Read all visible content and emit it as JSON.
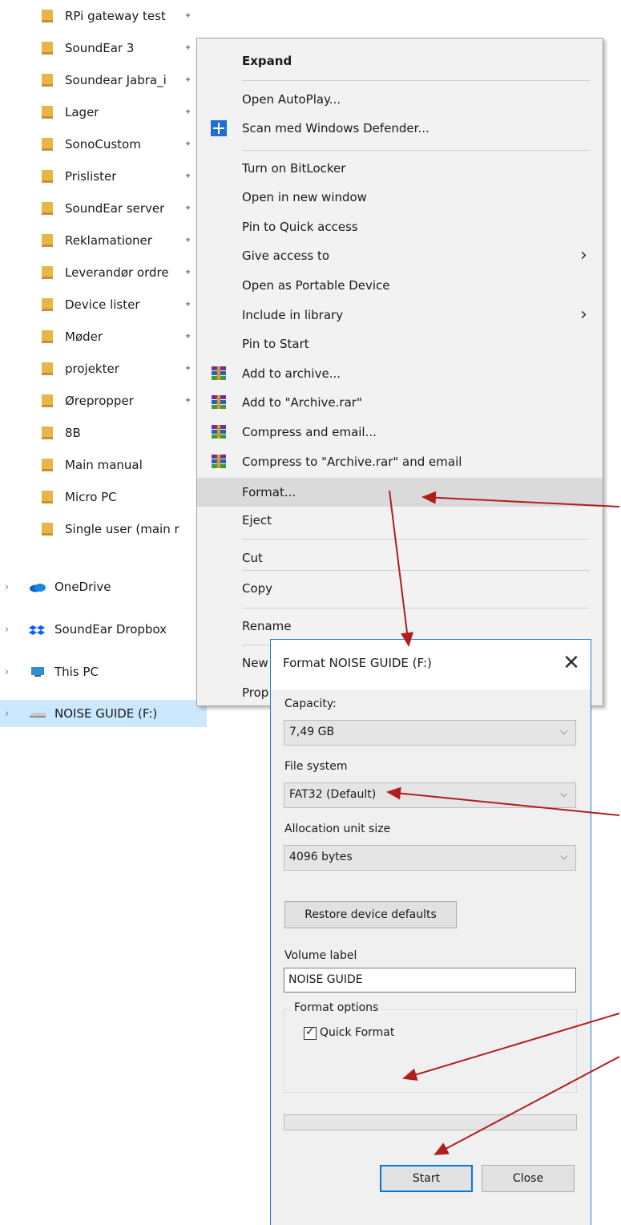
{
  "nav": {
    "folders": [
      {
        "label": "RPi gateway test",
        "pinned": true
      },
      {
        "label": "SoundEar 3",
        "pinned": true
      },
      {
        "label": "Soundear Jabra_i",
        "pinned": true
      },
      {
        "label": "Lager",
        "pinned": true
      },
      {
        "label": "SonoCustom",
        "pinned": true
      },
      {
        "label": "Prislister",
        "pinned": true
      },
      {
        "label": "SoundEar server",
        "pinned": true
      },
      {
        "label": "Reklamationer",
        "pinned": true
      },
      {
        "label": "Leverandør ordre",
        "pinned": true
      },
      {
        "label": "Device lister",
        "pinned": true
      },
      {
        "label": "Møder",
        "pinned": true
      },
      {
        "label": "projekter",
        "pinned": true
      },
      {
        "label": "Ørepropper",
        "pinned": true
      },
      {
        "label": "8B",
        "pinned": false
      },
      {
        "label": "Main manual",
        "pinned": false
      },
      {
        "label": "Micro PC",
        "pinned": false
      },
      {
        "label": "Single user (main r",
        "pinned": false
      }
    ],
    "roots": [
      {
        "label": "OneDrive",
        "icon": "onedrive-icon"
      },
      {
        "label": "SoundEar Dropbox",
        "icon": "dropbox-icon"
      },
      {
        "label": "This PC",
        "icon": "this-pc-icon"
      },
      {
        "label": "NOISE GUIDE (F:)",
        "icon": "usb-drive-icon",
        "selected": true
      }
    ]
  },
  "context_menu": {
    "items": [
      {
        "label": "Expand",
        "bold": true
      },
      {
        "label": "Open AutoPlay..."
      },
      {
        "label": "Scan med Windows Defender...",
        "icon": "windows-defender-icon"
      },
      {
        "label": "Turn on BitLocker"
      },
      {
        "label": "Open in new window"
      },
      {
        "label": "Pin to Quick access"
      },
      {
        "label": "Give access to",
        "submenu": true
      },
      {
        "label": "Open as Portable Device"
      },
      {
        "label": "Include in library",
        "submenu": true
      },
      {
        "label": "Pin to Start"
      },
      {
        "label": "Add to archive...",
        "icon": "winrar-icon"
      },
      {
        "label": "Add to \"Archive.rar\"",
        "icon": "winrar-icon"
      },
      {
        "label": "Compress and email...",
        "icon": "winrar-icon"
      },
      {
        "label": "Compress to \"Archive.rar\" and email",
        "icon": "winrar-icon"
      },
      {
        "label": "Format...",
        "highlighted": true
      },
      {
        "label": "Eject"
      },
      {
        "label": "Cut"
      },
      {
        "label": "Copy"
      },
      {
        "label": "Rename"
      },
      {
        "label": "New"
      },
      {
        "label": "Prop"
      }
    ]
  },
  "dialog": {
    "title": "Format NOISE GUIDE (F:)",
    "capacity_label": "Capacity:",
    "capacity_value": "7,49 GB",
    "filesystem_label": "File system",
    "filesystem_value": "FAT32 (Default)",
    "alloc_label": "Allocation unit size",
    "alloc_value": "4096 bytes",
    "restore_button": "Restore device defaults",
    "volume_label_label": "Volume label",
    "volume_label_value": "NOISE GUIDE",
    "format_options_label": "Format options",
    "quick_format_label": "Quick Format",
    "quick_format_checked": true,
    "progress": 0,
    "start_button": "Start",
    "close_button": "Close"
  },
  "colors": {
    "selection": "#cce8ff",
    "menu_background": "#f2f2f2",
    "menu_highlight": "#dadada",
    "dialog_border": "#1e7bd6",
    "annotation_arrow": "#b01e1e"
  }
}
